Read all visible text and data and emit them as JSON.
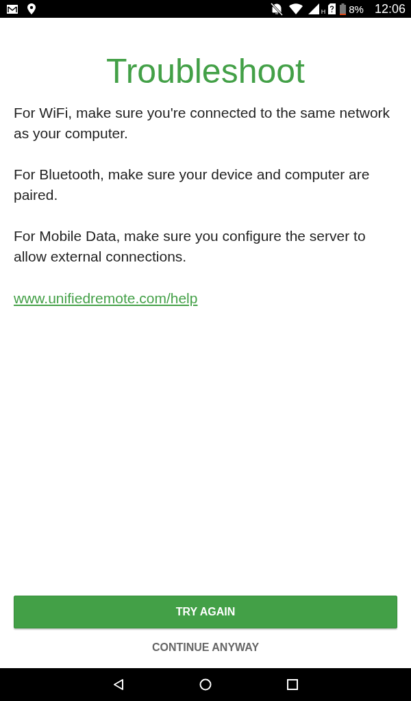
{
  "status_bar": {
    "network_type": "H",
    "battery": "8%",
    "time": "12:06"
  },
  "title": "Troubleshoot",
  "paragraphs": [
    "For WiFi, make sure you're connected to the same network as your computer.",
    "For Bluetooth, make sure your device and computer are paired.",
    "For Mobile Data, make sure you configure the server to allow external connections."
  ],
  "help_link": "www.unifiedremote.com/help",
  "buttons": [
    {
      "label": "TRY AGAIN",
      "kind": "primary"
    },
    {
      "label": "CONTINUE ANYWAY",
      "kind": "flat"
    }
  ]
}
